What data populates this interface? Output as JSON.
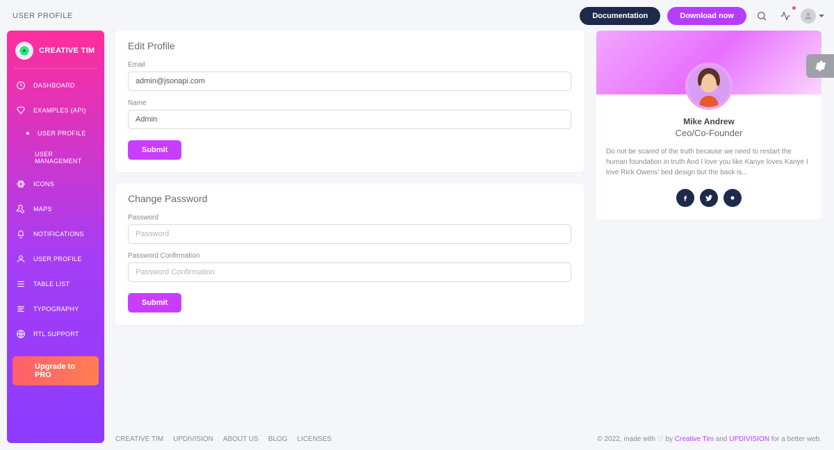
{
  "header": {
    "title": "USER PROFILE",
    "documentation": "Documentation",
    "download": "Download now"
  },
  "sidebar": {
    "brand": "CREATIVE TIM",
    "items": [
      {
        "label": "DASHBOARD",
        "icon": "dashboard-icon"
      },
      {
        "label": "EXAMPLES (API)",
        "icon": "diamond-icon"
      }
    ],
    "subitems": [
      {
        "label": "USER PROFILE",
        "active": true
      },
      {
        "label": "USER MANAGEMENT",
        "active": false
      }
    ],
    "items2": [
      {
        "label": "ICONS",
        "icon": "atom-icon"
      },
      {
        "label": "MAPS",
        "icon": "pin-icon"
      },
      {
        "label": "NOTIFICATIONS",
        "icon": "bell-icon"
      },
      {
        "label": "USER PROFILE",
        "icon": "user-icon"
      },
      {
        "label": "TABLE LIST",
        "icon": "list-icon"
      },
      {
        "label": "TYPOGRAPHY",
        "icon": "text-icon"
      },
      {
        "label": "RTL SUPPORT",
        "icon": "globe-icon"
      }
    ],
    "upgrade": "Upgrade to PRO"
  },
  "edit_profile": {
    "title": "Edit Profile",
    "email_label": "Email",
    "email_value": "admin@jsonapi.com",
    "name_label": "Name",
    "name_value": "Admin",
    "submit": "Submit"
  },
  "change_password": {
    "title": "Change Password",
    "password_label": "Password",
    "password_placeholder": "Password",
    "confirm_label": "Password Confirmation",
    "confirm_placeholder": "Password Confirmation",
    "submit": "Submit"
  },
  "profile_card": {
    "name": "Mike Andrew",
    "role": "Ceo/Co-Founder",
    "bio": "Do not be scared of the truth because we need to restart the human foundation in truth And I love you like Kanye loves Kanye I love Rick Owens' bed design but the back is..."
  },
  "footer": {
    "links": [
      "CREATIVE TIM",
      "UPDIVISION",
      "ABOUT US",
      "BLOG",
      "LICENSES"
    ],
    "copyright_prefix": "© 2022, made with ♡ by ",
    "link1": "Creative Tim",
    "mid": " and ",
    "link2": "UPDIVISION",
    "suffix": " for a better web."
  }
}
